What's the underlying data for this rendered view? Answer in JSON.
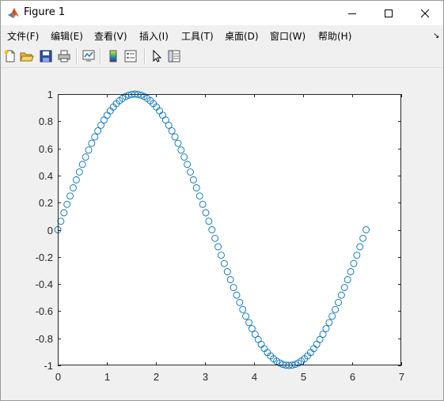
{
  "window": {
    "title": "Figure 1",
    "app_icon": "matlab-logo-icon",
    "controls": [
      "minimize-icon",
      "maximize-icon",
      "close-icon"
    ]
  },
  "menubar": {
    "items": [
      {
        "label": "文件(F)"
      },
      {
        "label": "编辑(E)"
      },
      {
        "label": "查看(V)"
      },
      {
        "label": "插入(I)"
      },
      {
        "label": "工具(T)"
      },
      {
        "label": "桌面(D)"
      },
      {
        "label": "窗口(W)"
      },
      {
        "label": "帮助(H)"
      }
    ],
    "dock_arrow": "↘"
  },
  "toolbar": {
    "tools": [
      "new-figure-icon",
      "open-file-icon",
      "save-icon",
      "print-icon",
      "link-plot-icon",
      "insert-colorbar-icon",
      "insert-legend-icon",
      "edit-plot-arrow-icon",
      "property-inspector-icon"
    ]
  },
  "colors": {
    "marker": "#0072bd",
    "axes": "#262626",
    "plot_background": "#ffffff",
    "figure_background": "#f0f0f0"
  },
  "chart_data": {
    "type": "scatter",
    "marker": "o",
    "title": "",
    "xlabel": "",
    "ylabel": "",
    "xlim": [
      0,
      7
    ],
    "ylim": [
      -1,
      1
    ],
    "xticks": [
      "0",
      "1",
      "2",
      "3",
      "4",
      "5",
      "6",
      "7"
    ],
    "yticks": [
      "-1",
      "-0.8",
      "-0.6",
      "-0.4",
      "-0.2",
      "0",
      "0.2",
      "0.4",
      "0.6",
      "0.8",
      "1"
    ],
    "grid": false,
    "x": [
      0,
      0.0628,
      0.1257,
      0.1885,
      0.2513,
      0.3142,
      0.377,
      0.4398,
      0.5027,
      0.5655,
      0.6283,
      0.6912,
      0.754,
      0.8168,
      0.8796,
      0.9425,
      1.0053,
      1.0681,
      1.131,
      1.1938,
      1.2566,
      1.3195,
      1.3823,
      1.4451,
      1.508,
      1.5708,
      1.6336,
      1.6965,
      1.7593,
      1.8221,
      1.885,
      1.9478,
      2.0106,
      2.0735,
      2.1363,
      2.1991,
      2.2619,
      2.3248,
      2.3876,
      2.4504,
      2.5133,
      2.5761,
      2.6389,
      2.7018,
      2.7646,
      2.8274,
      2.8903,
      2.9531,
      3.0159,
      3.0788,
      3.1416,
      3.2044,
      3.2673,
      3.3301,
      3.3929,
      3.4558,
      3.5186,
      3.5814,
      3.6442,
      3.7071,
      3.7699,
      3.8327,
      3.8956,
      3.9584,
      4.0212,
      4.0841,
      4.1469,
      4.2097,
      4.2726,
      4.3354,
      4.3982,
      4.4611,
      4.5239,
      4.5867,
      4.6496,
      4.7124,
      4.7752,
      4.8381,
      4.9009,
      4.9637,
      5.0265,
      5.0894,
      5.1522,
      5.215,
      5.2779,
      5.3407,
      5.4035,
      5.4664,
      5.5292,
      5.592,
      5.6549,
      5.7177,
      5.7805,
      5.8434,
      5.9062,
      5.969,
      6.0319,
      6.0947,
      6.1575,
      6.2204,
      6.2832
    ],
    "y": [
      0,
      0.0628,
      0.1253,
      0.1874,
      0.2487,
      0.309,
      0.3681,
      0.4258,
      0.4818,
      0.5358,
      0.5878,
      0.6374,
      0.6845,
      0.729,
      0.7705,
      0.809,
      0.8443,
      0.8763,
      0.9048,
      0.9298,
      0.9511,
      0.9686,
      0.9823,
      0.9921,
      0.998,
      1,
      0.998,
      0.9921,
      0.9823,
      0.9686,
      0.9511,
      0.9298,
      0.9048,
      0.8763,
      0.8443,
      0.809,
      0.7705,
      0.729,
      0.6845,
      0.6374,
      0.5878,
      0.5358,
      0.4818,
      0.4258,
      0.3681,
      0.309,
      0.2487,
      0.1874,
      0.1253,
      0.0628,
      0,
      -0.0628,
      -0.1253,
      -0.1874,
      -0.2487,
      -0.309,
      -0.3681,
      -0.4258,
      -0.4818,
      -0.5358,
      -0.5878,
      -0.6374,
      -0.6845,
      -0.729,
      -0.7705,
      -0.809,
      -0.8443,
      -0.8763,
      -0.9048,
      -0.9298,
      -0.9511,
      -0.9686,
      -0.9823,
      -0.9921,
      -0.998,
      -1,
      -0.998,
      -0.9921,
      -0.9823,
      -0.9686,
      -0.9511,
      -0.9298,
      -0.9048,
      -0.8763,
      -0.8443,
      -0.809,
      -0.7705,
      -0.729,
      -0.6845,
      -0.6374,
      -0.5878,
      -0.5358,
      -0.4818,
      -0.4258,
      -0.3681,
      -0.309,
      -0.2487,
      -0.1874,
      -0.1253,
      -0.0628,
      0
    ]
  }
}
